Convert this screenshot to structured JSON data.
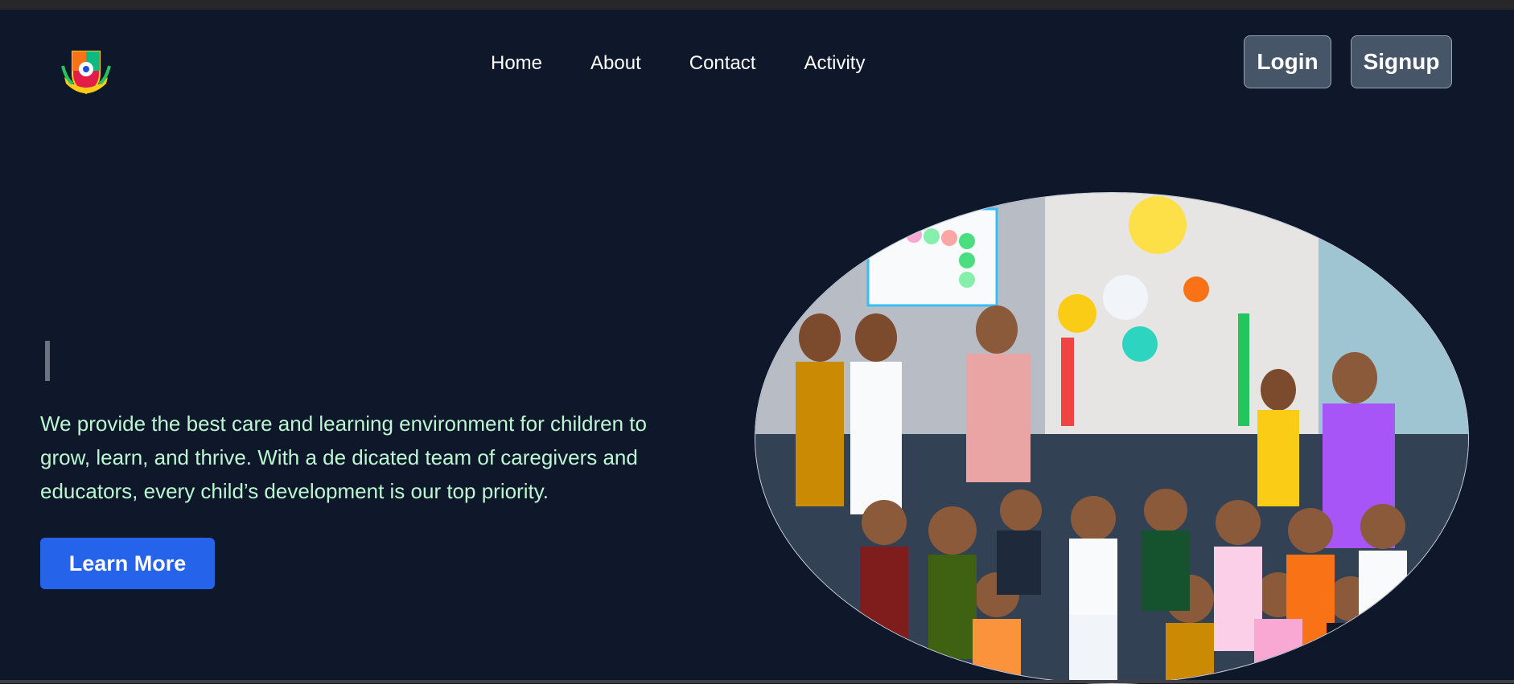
{
  "nav": {
    "logo_icon": "school-crest-logo-icon",
    "links": [
      {
        "label": "Home"
      },
      {
        "label": "About"
      },
      {
        "label": "Contact"
      },
      {
        "label": "Activity"
      }
    ]
  },
  "auth": {
    "login_label": "Login",
    "signup_label": "Signup"
  },
  "hero": {
    "description": "We provide the best care and learning environment for children to grow, learn, and thrive. With a de dicated team of caregivers and educators, every child’s development is our top priority.",
    "cta_label": "Learn More",
    "image_subject": "group-photo-children-teachers"
  },
  "colors": {
    "background": "#0f172a",
    "hero_text": "#bbf7d0",
    "cta": "#2563eb",
    "auth_button": "#475569"
  }
}
